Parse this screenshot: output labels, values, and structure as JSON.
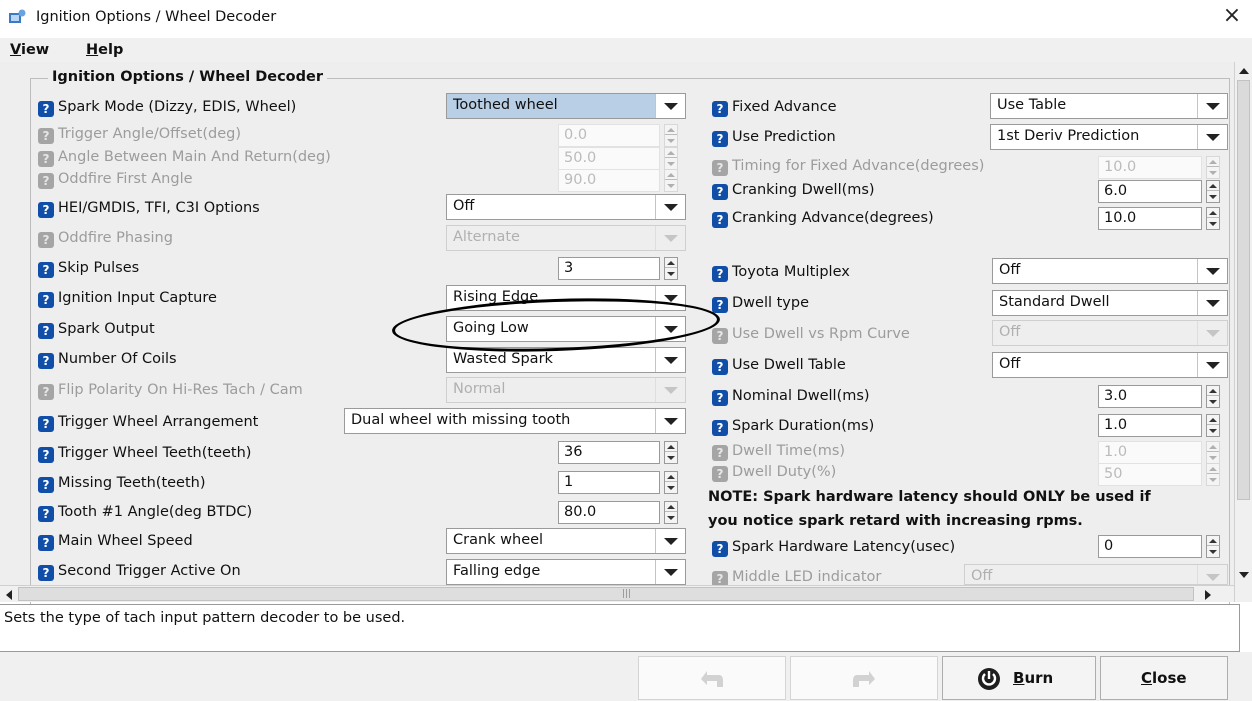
{
  "window": {
    "title": "Ignition Options / Wheel Decoder"
  },
  "menu": {
    "view": "View",
    "help": "Help"
  },
  "group_title": "Ignition Options / Wheel Decoder",
  "left": {
    "spark_mode": {
      "label": "Spark Mode (Dizzy, EDIS, Wheel)",
      "value": "Toothed wheel"
    },
    "trigger_angle": {
      "label": "Trigger Angle/Offset(deg)",
      "value": "0.0"
    },
    "angle_main_return": {
      "label": "Angle Between Main And Return(deg)",
      "value": "50.0"
    },
    "oddfire_first_angle": {
      "label": "Oddfire First Angle",
      "value": "90.0"
    },
    "hei_options": {
      "label": "HEI/GMDIS, TFI, C3I Options",
      "value": "Off"
    },
    "oddfire_phasing": {
      "label": "Oddfire Phasing",
      "value": "Alternate"
    },
    "skip_pulses": {
      "label": "Skip Pulses",
      "value": "3"
    },
    "ignition_input_capture": {
      "label": "Ignition Input Capture",
      "value": "Rising Edge"
    },
    "spark_output": {
      "label": "Spark Output",
      "value": "Going Low"
    },
    "number_of_coils": {
      "label": "Number Of Coils",
      "value": "Wasted Spark"
    },
    "flip_polarity": {
      "label": "Flip Polarity On Hi-Res Tach / Cam",
      "value": "Normal"
    },
    "trigger_wheel_arrangement": {
      "label": "Trigger Wheel Arrangement",
      "value": "Dual wheel with missing tooth"
    },
    "trigger_wheel_teeth": {
      "label": "Trigger Wheel Teeth(teeth)",
      "value": "36"
    },
    "missing_teeth": {
      "label": "Missing Teeth(teeth)",
      "value": "1"
    },
    "tooth1_angle": {
      "label": "Tooth #1 Angle(deg BTDC)",
      "value": "80.0"
    },
    "main_wheel_speed": {
      "label": "Main Wheel Speed",
      "value": "Crank wheel"
    },
    "second_trigger_active": {
      "label": "Second Trigger Active On",
      "value": "Falling edge"
    }
  },
  "right": {
    "fixed_advance": {
      "label": "Fixed Advance",
      "value": "Use Table"
    },
    "use_prediction": {
      "label": "Use Prediction",
      "value": "1st Deriv Prediction"
    },
    "timing_fixed_advance": {
      "label": "Timing for Fixed Advance(degrees)",
      "value": "10.0"
    },
    "cranking_dwell": {
      "label": "Cranking Dwell(ms)",
      "value": "6.0"
    },
    "cranking_advance": {
      "label": "Cranking Advance(degrees)",
      "value": "10.0"
    },
    "toyota_multiplex": {
      "label": "Toyota Multiplex",
      "value": "Off"
    },
    "dwell_type": {
      "label": "Dwell type",
      "value": "Standard Dwell"
    },
    "use_dwell_vs_rpm": {
      "label": "Use Dwell vs Rpm Curve",
      "value": "Off"
    },
    "use_dwell_table": {
      "label": "Use Dwell Table",
      "value": "Off"
    },
    "nominal_dwell": {
      "label": "Nominal Dwell(ms)",
      "value": "3.0"
    },
    "spark_duration": {
      "label": "Spark Duration(ms)",
      "value": "1.0"
    },
    "dwell_time": {
      "label": "Dwell Time(ms)",
      "value": "1.0"
    },
    "dwell_duty": {
      "label": "Dwell Duty(%)",
      "value": "50"
    },
    "note_line1": "NOTE: Spark hardware latency should ONLY be used if",
    "note_line2": "you notice spark retard with increasing rpms.",
    "spark_hw_latency": {
      "label": "Spark Hardware Latency(usec)",
      "value": "0"
    },
    "middle_led": {
      "label": "Middle LED indicator",
      "value": "Off"
    }
  },
  "status_text": "Sets the type of tach input pattern decoder to be used.",
  "buttons": {
    "burn": "Burn",
    "close": "Close"
  },
  "help_glyph": "?"
}
